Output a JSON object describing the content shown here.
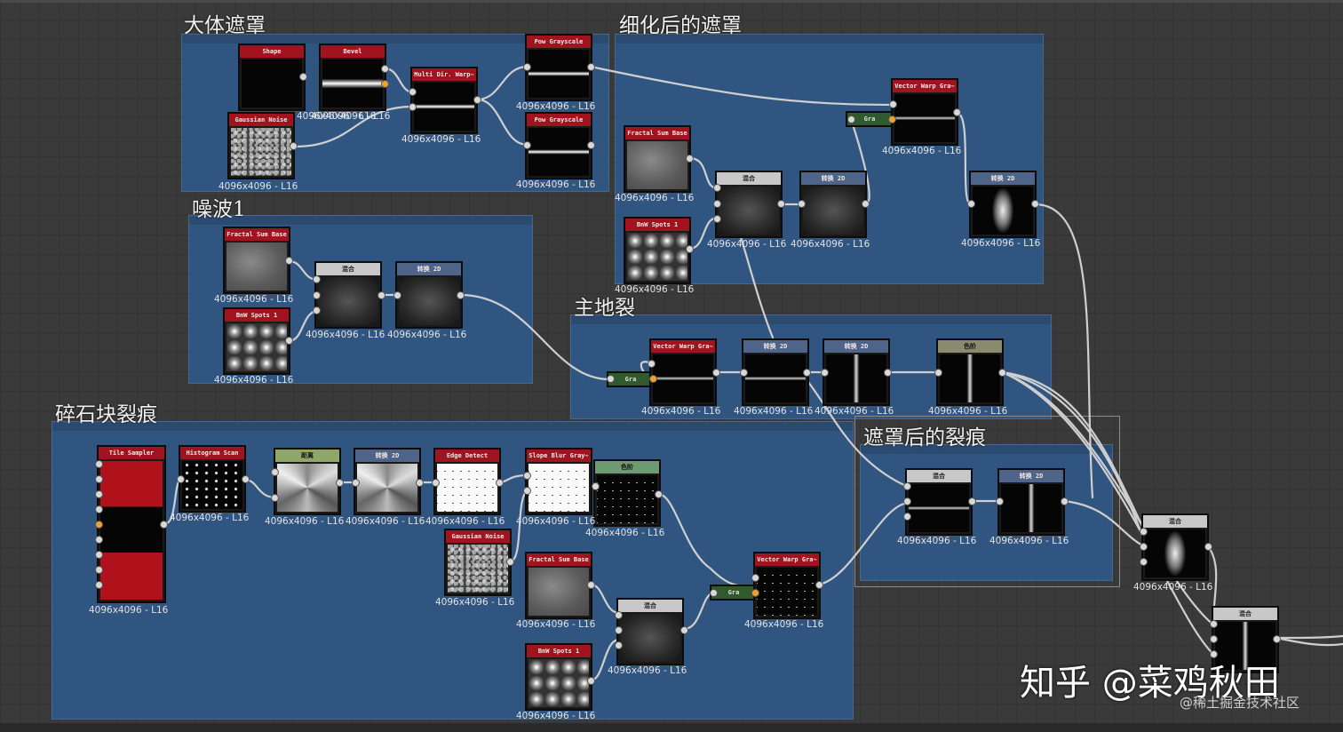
{
  "frames": {
    "rough_mask": "大体遮罩",
    "refined_mask": "细化后的遮罩",
    "noise1": "噪波1",
    "main_crack": "主地裂",
    "rubble_cracks": "碎石块裂痕",
    "masked_cracks": "遮罩后的裂痕"
  },
  "nodes": [
    {
      "id": "shape",
      "title": "Shape",
      "res": "4096x4096 - L16",
      "color": "red"
    },
    {
      "id": "bevel",
      "title": "Bevel",
      "res": "4096x4096 - L16",
      "color": "red"
    },
    {
      "id": "gauss1",
      "title": "Gaussian Noise",
      "res": "4096x4096 - L16",
      "color": "red"
    },
    {
      "id": "multidir",
      "title": "Multi Dir. Warp~",
      "res": "4096x4096 - L16",
      "color": "red"
    },
    {
      "id": "pow1",
      "title": "Pow Grayscale",
      "res": "4096x4096 - L16",
      "color": "red"
    },
    {
      "id": "pow2",
      "title": "Pow Grayscale",
      "res": "4096x4096 - L16",
      "color": "red"
    },
    {
      "id": "fractal1",
      "title": "Fractal Sum Base",
      "res": "4096x4096 - L16",
      "color": "red"
    },
    {
      "id": "bnw1",
      "title": "BnW Spots 1",
      "res": "4096x4096 - L16",
      "color": "red"
    },
    {
      "id": "blend1",
      "title": "混合",
      "res": "4096x4096 - L16",
      "color": "gray"
    },
    {
      "id": "trans1",
      "title": "转换 2D",
      "res": "4096x4096 - L16",
      "color": "blue"
    },
    {
      "id": "fractal2",
      "title": "Fractal Sum Base",
      "res": "4096x4096 - L16",
      "color": "red"
    },
    {
      "id": "bnw2",
      "title": "BnW Spots 1",
      "res": "4096x4096 - L16",
      "color": "red"
    },
    {
      "id": "blend2",
      "title": "混合",
      "res": "4096x4096 - L16",
      "color": "gray"
    },
    {
      "id": "trans2",
      "title": "转换 2D",
      "res": "4096x4096 - L16",
      "color": "blue"
    },
    {
      "id": "gra1",
      "title": "Gra",
      "res": "",
      "color": "green"
    },
    {
      "id": "vwarp1",
      "title": "Vector Warp Gra~",
      "res": "4096x4096 - L16",
      "color": "red"
    },
    {
      "id": "trans3",
      "title": "转换 2D",
      "res": "4096x4096 - L16",
      "color": "blue"
    },
    {
      "id": "gra2",
      "title": "Gra",
      "res": "",
      "color": "green"
    },
    {
      "id": "vwarp2",
      "title": "Vector Warp Gra~",
      "res": "4096x4096 - L16",
      "color": "red"
    },
    {
      "id": "trans4",
      "title": "转换 2D",
      "res": "4096x4096 - L16",
      "color": "blue"
    },
    {
      "id": "trans5",
      "title": "转换 2D",
      "res": "4096x4096 - L16",
      "color": "blue"
    },
    {
      "id": "levels1",
      "title": "色阶",
      "res": "4096x4096 - L16",
      "color": "olive"
    },
    {
      "id": "tile",
      "title": "Tile Sampler",
      "res": "4096x4096 - L16",
      "color": "red"
    },
    {
      "id": "hist",
      "title": "Histogram Scan",
      "res": "4096x4096 - L16",
      "color": "red"
    },
    {
      "id": "dist",
      "title": "距离",
      "res": "4096x4096 - L16",
      "color": "green"
    },
    {
      "id": "trans6",
      "title": "转换 2D",
      "res": "4096x4096 - L16",
      "color": "blue"
    },
    {
      "id": "edge",
      "title": "Edge Detect",
      "res": "4096x4096 - L16",
      "color": "red"
    },
    {
      "id": "slope",
      "title": "Slope Blur Gray~",
      "res": "4096x4096 - L16",
      "color": "red"
    },
    {
      "id": "levels2",
      "title": "色阶",
      "res": "4096x4096 - L16",
      "color": "green"
    },
    {
      "id": "gauss2",
      "title": "Gaussian Noise",
      "res": "4096x4096 - L16",
      "color": "red"
    },
    {
      "id": "fractal3",
      "title": "Fractal Sum Base",
      "res": "4096x4096 - L16",
      "color": "red"
    },
    {
      "id": "blend3",
      "title": "混合",
      "res": "4096x4096 - L16",
      "color": "gray"
    },
    {
      "id": "bnw3",
      "title": "BnW Spots 1",
      "res": "4096x4096 - L16",
      "color": "red"
    },
    {
      "id": "gra3",
      "title": "Gra",
      "res": "",
      "color": "green"
    },
    {
      "id": "vwarp3",
      "title": "Vector Warp Gra~",
      "res": "4096x4096 - L16",
      "color": "red"
    },
    {
      "id": "blend4",
      "title": "混合",
      "res": "4096x4096 - L16",
      "color": "gray"
    },
    {
      "id": "trans7",
      "title": "转换 2D",
      "res": "4096x4096 - L16",
      "color": "blue"
    },
    {
      "id": "blend5",
      "title": "混合",
      "res": "4096x4096 - L16",
      "color": "gray"
    },
    {
      "id": "blend6",
      "title": "混合",
      "res": "",
      "color": "gray"
    }
  ],
  "watermark": {
    "main": "知乎 @菜鸡秋田",
    "sub": "@稀土掘金技术社区"
  }
}
